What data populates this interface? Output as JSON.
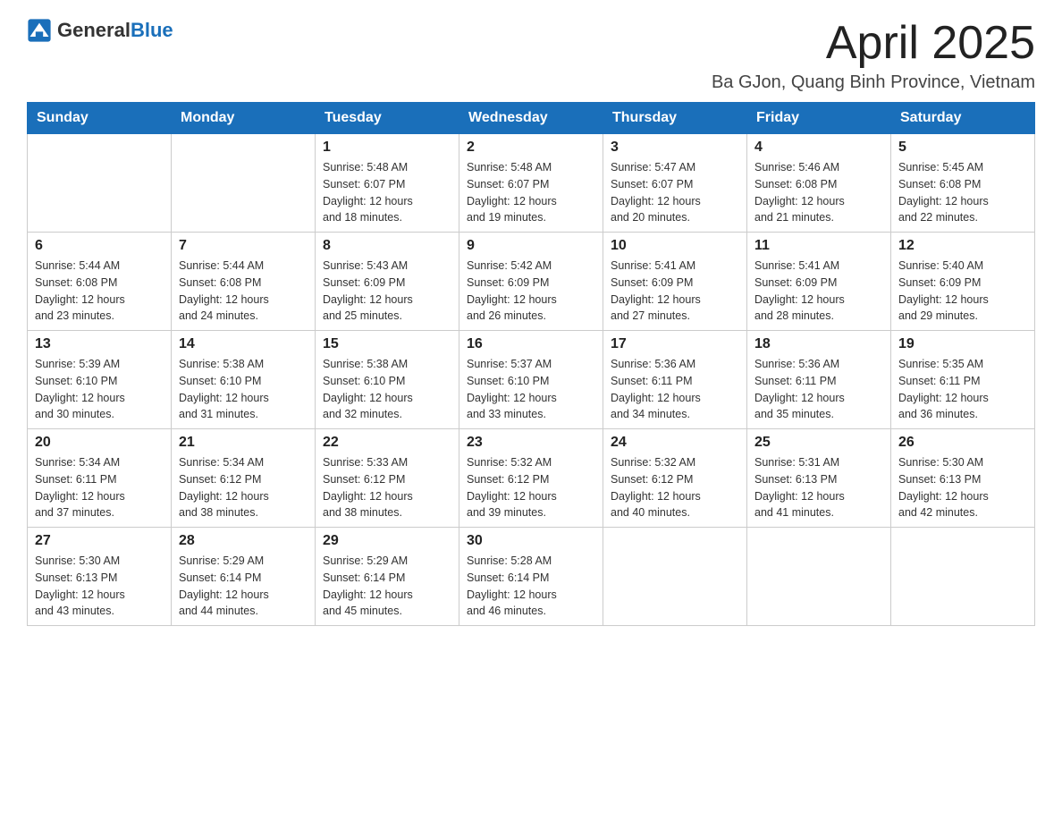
{
  "logo": {
    "text_general": "General",
    "text_blue": "Blue"
  },
  "title": "April 2025",
  "subtitle": "Ba GJon, Quang Binh Province, Vietnam",
  "days_of_week": [
    "Sunday",
    "Monday",
    "Tuesday",
    "Wednesday",
    "Thursday",
    "Friday",
    "Saturday"
  ],
  "weeks": [
    [
      {
        "day": "",
        "info": ""
      },
      {
        "day": "",
        "info": ""
      },
      {
        "day": "1",
        "info": "Sunrise: 5:48 AM\nSunset: 6:07 PM\nDaylight: 12 hours\nand 18 minutes."
      },
      {
        "day": "2",
        "info": "Sunrise: 5:48 AM\nSunset: 6:07 PM\nDaylight: 12 hours\nand 19 minutes."
      },
      {
        "day": "3",
        "info": "Sunrise: 5:47 AM\nSunset: 6:07 PM\nDaylight: 12 hours\nand 20 minutes."
      },
      {
        "day": "4",
        "info": "Sunrise: 5:46 AM\nSunset: 6:08 PM\nDaylight: 12 hours\nand 21 minutes."
      },
      {
        "day": "5",
        "info": "Sunrise: 5:45 AM\nSunset: 6:08 PM\nDaylight: 12 hours\nand 22 minutes."
      }
    ],
    [
      {
        "day": "6",
        "info": "Sunrise: 5:44 AM\nSunset: 6:08 PM\nDaylight: 12 hours\nand 23 minutes."
      },
      {
        "day": "7",
        "info": "Sunrise: 5:44 AM\nSunset: 6:08 PM\nDaylight: 12 hours\nand 24 minutes."
      },
      {
        "day": "8",
        "info": "Sunrise: 5:43 AM\nSunset: 6:09 PM\nDaylight: 12 hours\nand 25 minutes."
      },
      {
        "day": "9",
        "info": "Sunrise: 5:42 AM\nSunset: 6:09 PM\nDaylight: 12 hours\nand 26 minutes."
      },
      {
        "day": "10",
        "info": "Sunrise: 5:41 AM\nSunset: 6:09 PM\nDaylight: 12 hours\nand 27 minutes."
      },
      {
        "day": "11",
        "info": "Sunrise: 5:41 AM\nSunset: 6:09 PM\nDaylight: 12 hours\nand 28 minutes."
      },
      {
        "day": "12",
        "info": "Sunrise: 5:40 AM\nSunset: 6:09 PM\nDaylight: 12 hours\nand 29 minutes."
      }
    ],
    [
      {
        "day": "13",
        "info": "Sunrise: 5:39 AM\nSunset: 6:10 PM\nDaylight: 12 hours\nand 30 minutes."
      },
      {
        "day": "14",
        "info": "Sunrise: 5:38 AM\nSunset: 6:10 PM\nDaylight: 12 hours\nand 31 minutes."
      },
      {
        "day": "15",
        "info": "Sunrise: 5:38 AM\nSunset: 6:10 PM\nDaylight: 12 hours\nand 32 minutes."
      },
      {
        "day": "16",
        "info": "Sunrise: 5:37 AM\nSunset: 6:10 PM\nDaylight: 12 hours\nand 33 minutes."
      },
      {
        "day": "17",
        "info": "Sunrise: 5:36 AM\nSunset: 6:11 PM\nDaylight: 12 hours\nand 34 minutes."
      },
      {
        "day": "18",
        "info": "Sunrise: 5:36 AM\nSunset: 6:11 PM\nDaylight: 12 hours\nand 35 minutes."
      },
      {
        "day": "19",
        "info": "Sunrise: 5:35 AM\nSunset: 6:11 PM\nDaylight: 12 hours\nand 36 minutes."
      }
    ],
    [
      {
        "day": "20",
        "info": "Sunrise: 5:34 AM\nSunset: 6:11 PM\nDaylight: 12 hours\nand 37 minutes."
      },
      {
        "day": "21",
        "info": "Sunrise: 5:34 AM\nSunset: 6:12 PM\nDaylight: 12 hours\nand 38 minutes."
      },
      {
        "day": "22",
        "info": "Sunrise: 5:33 AM\nSunset: 6:12 PM\nDaylight: 12 hours\nand 38 minutes."
      },
      {
        "day": "23",
        "info": "Sunrise: 5:32 AM\nSunset: 6:12 PM\nDaylight: 12 hours\nand 39 minutes."
      },
      {
        "day": "24",
        "info": "Sunrise: 5:32 AM\nSunset: 6:12 PM\nDaylight: 12 hours\nand 40 minutes."
      },
      {
        "day": "25",
        "info": "Sunrise: 5:31 AM\nSunset: 6:13 PM\nDaylight: 12 hours\nand 41 minutes."
      },
      {
        "day": "26",
        "info": "Sunrise: 5:30 AM\nSunset: 6:13 PM\nDaylight: 12 hours\nand 42 minutes."
      }
    ],
    [
      {
        "day": "27",
        "info": "Sunrise: 5:30 AM\nSunset: 6:13 PM\nDaylight: 12 hours\nand 43 minutes."
      },
      {
        "day": "28",
        "info": "Sunrise: 5:29 AM\nSunset: 6:14 PM\nDaylight: 12 hours\nand 44 minutes."
      },
      {
        "day": "29",
        "info": "Sunrise: 5:29 AM\nSunset: 6:14 PM\nDaylight: 12 hours\nand 45 minutes."
      },
      {
        "day": "30",
        "info": "Sunrise: 5:28 AM\nSunset: 6:14 PM\nDaylight: 12 hours\nand 46 minutes."
      },
      {
        "day": "",
        "info": ""
      },
      {
        "day": "",
        "info": ""
      },
      {
        "day": "",
        "info": ""
      }
    ]
  ]
}
